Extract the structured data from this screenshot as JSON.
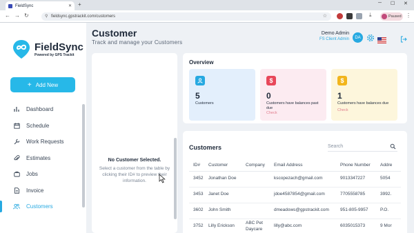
{
  "browser": {
    "tab_title": "FieldSync",
    "url": "fieldsync.gpstrackit.com/customers",
    "profile_label": "Paused"
  },
  "sidebar": {
    "logo_name": "FieldSync",
    "logo_tagline": "Powered by GPS Trackit",
    "add_new_label": "Add New",
    "items": [
      {
        "label": "Dashboard",
        "icon": "bar-chart-icon"
      },
      {
        "label": "Schedule",
        "icon": "calendar-icon"
      },
      {
        "label": "Work Requests",
        "icon": "wrench-icon"
      },
      {
        "label": "Estimates",
        "icon": "paperclip-icon"
      },
      {
        "label": "Jobs",
        "icon": "briefcase-icon"
      },
      {
        "label": "Invoice",
        "icon": "document-icon"
      },
      {
        "label": "Customers",
        "icon": "users-icon",
        "active": true
      }
    ]
  },
  "header": {
    "title": "Customer",
    "subtitle": "Track and manage your Customers",
    "user_name": "Demo Admin",
    "user_role": "FS Client Admin",
    "avatar_initials": "DA"
  },
  "detail_panel": {
    "title": "No Customer Selected.",
    "description": "Select a customer from the table by clicking their ID# to preview their information."
  },
  "overview": {
    "title": "Overview",
    "stats": [
      {
        "value": "5",
        "label": "Customers",
        "link": "",
        "color": "#27a9e1",
        "bg": "#e3effc"
      },
      {
        "value": "0",
        "label": "Customers have balances past due",
        "link": "Check",
        "color": "#e8475a",
        "bg": "#fcebf1"
      },
      {
        "value": "1",
        "label": "Customers have balances due",
        "link": "Check",
        "color": "#f2b51c",
        "bg": "#fdf6dc"
      }
    ]
  },
  "customers": {
    "title": "Customers",
    "search_placeholder": "Search",
    "columns": [
      "ID#",
      "Customer",
      "Company",
      "Email Address",
      "Phone Number",
      "Addre"
    ],
    "rows": [
      {
        "id": "3452",
        "customer": "Jonathan Doe",
        "company": "",
        "email": "kscopezach@gmail.com",
        "phone": "9013347227",
        "address": "5054"
      },
      {
        "id": "3453",
        "customer": "Janet Doe",
        "company": "",
        "email": "jdoe4587854@gmail.com",
        "phone": "7705558785",
        "address": "3992."
      },
      {
        "id": "3602",
        "customer": "John Smith",
        "company": "",
        "email": "dmeadows@gpstrackit.com",
        "phone": "951-805-9957",
        "address": "P.O."
      },
      {
        "id": "3752",
        "customer": "Lilly Erickson",
        "company": "ABC Pet Daycare",
        "email": "lilly@abc.com",
        "phone": "6035015373",
        "address": "9 Mor"
      }
    ]
  }
}
